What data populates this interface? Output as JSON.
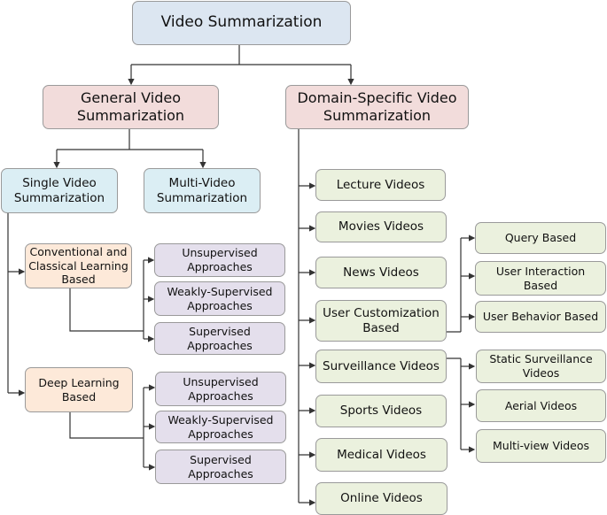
{
  "root": "Video Summarization",
  "general": "General Video Summarization",
  "domain": "Domain-Specific Video Summarization",
  "single": "Single Video Summarization",
  "multi": "Multi-Video Summarization",
  "conventional": "Conventional and Classical Learning Based",
  "deep": "Deep Learning Based",
  "conventional_children": [
    "Unsupervised Approaches",
    "Weakly-Supervised Approaches",
    "Supervised Approaches"
  ],
  "deep_children": [
    "Unsupervised Approaches",
    "Weakly-Supervised Approaches",
    "Supervised Approaches"
  ],
  "domains": [
    "Lecture Videos",
    "Movies Videos",
    "News Videos",
    "User Customization Based",
    "Surveillance Videos",
    "Sports Videos",
    "Medical Videos",
    "Online Videos"
  ],
  "user_customization_children": [
    "Query Based",
    "User Interaction Based",
    "User Behavior Based"
  ],
  "surveillance_children": [
    "Static Surveillance Videos",
    "Aerial Videos",
    "Multi-view Videos"
  ],
  "colors": {
    "root": "#dce6f1",
    "level1": "#f2dcdb",
    "level2": "#dbeef4",
    "method": "#fde9d9",
    "approach": "#e4dfec",
    "domain": "#ebf1de",
    "line": "#333333"
  }
}
